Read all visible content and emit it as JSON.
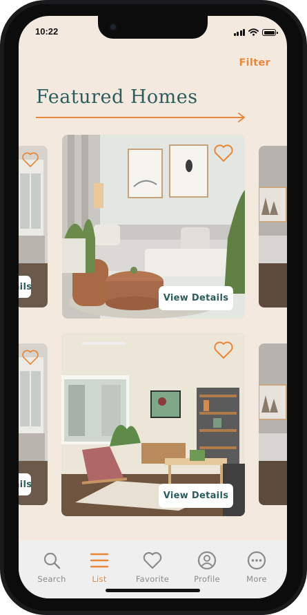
{
  "status_bar": {
    "time": "10:22"
  },
  "header": {
    "filter_label": "Filter",
    "title": "Featured Homes"
  },
  "listings": [
    {
      "row": 1,
      "position": "left-peek",
      "button_label": "View Details"
    },
    {
      "row": 1,
      "position": "center",
      "button_label": "View Details"
    },
    {
      "row": 1,
      "position": "right-peek"
    },
    {
      "row": 2,
      "position": "left-peek",
      "button_label": "View Details"
    },
    {
      "row": 2,
      "position": "center",
      "button_label": "View Details"
    },
    {
      "row": 2,
      "position": "right-peek"
    }
  ],
  "bottom_nav": {
    "active": "List",
    "items": [
      {
        "label": "Search",
        "icon": "search-icon"
      },
      {
        "label": "List",
        "icon": "list-icon"
      },
      {
        "label": "Favorite",
        "icon": "heart-icon"
      },
      {
        "label": "Profile",
        "icon": "profile-icon"
      },
      {
        "label": "More",
        "icon": "more-icon"
      }
    ]
  },
  "colors": {
    "accent": "#e8873a",
    "title": "#2b5c5e",
    "background": "#f4e9df",
    "nav_background": "#efefef"
  }
}
